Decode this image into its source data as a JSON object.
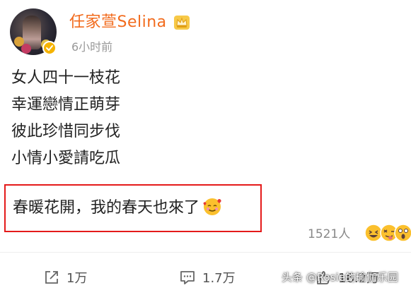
{
  "post": {
    "username": "任家萱Selina",
    "time": "6小时前",
    "lines": [
      "女人四十一枝花",
      "幸運戀情正萌芽",
      "彼此珍惜同步伐",
      "小情小愛請吃瓜"
    ],
    "highlight_text": "春暖花開，我的春天也來了",
    "likes": "1521人"
  },
  "actions": {
    "share": "1万",
    "comment": "1.7万",
    "like": "16.2万"
  },
  "watermark": "头条 @Rosie的瑜伽乐园",
  "icons": {
    "verified": "verified-badge-icon",
    "crown": "crown-icon",
    "blush": "smiling-face-with-hearts-icon",
    "share": "share-icon",
    "comment": "comment-icon",
    "like": "thumbs-up-icon"
  },
  "colors": {
    "username": "#f26b1d",
    "highlight_border": "#e41a1a",
    "verified": "#f5b300"
  }
}
